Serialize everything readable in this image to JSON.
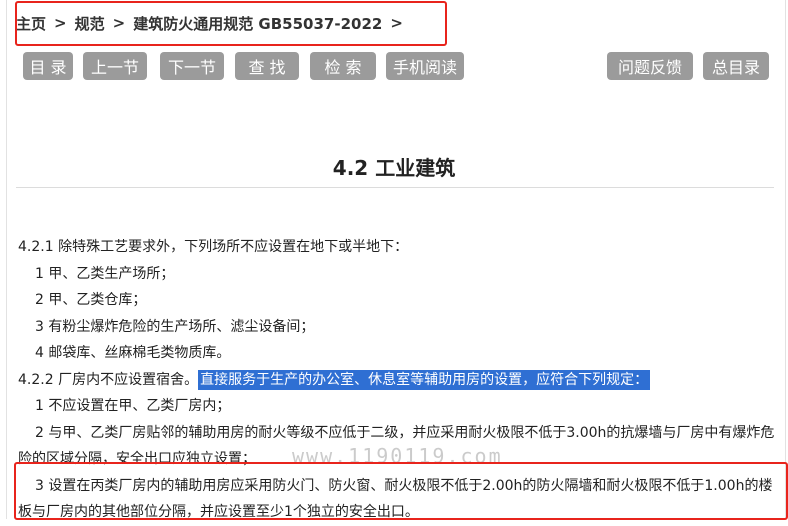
{
  "breadcrumb": {
    "home": "主页",
    "sep": ">",
    "category": "规范",
    "current": "建筑防火通用规范 GB55037-2022"
  },
  "toolbar": {
    "catalog": "目 录",
    "prev": "上一节",
    "next": "下一节",
    "find": "查 找",
    "search": "检 索",
    "mobile": "手机阅读",
    "feedback": "问题反馈",
    "main_catalog": "总目录"
  },
  "page": {
    "title": "4.2 工业建筑"
  },
  "content": {
    "p1": "4.2.1 除特殊工艺要求外，下列场所不应设置在地下或半地下：",
    "p1_item1": "1 甲、乙类生产场所；",
    "p1_item2": "2 甲、乙类仓库；",
    "p1_item3": "3 有粉尘爆炸危险的生产场所、滤尘设备间；",
    "p1_item4": "4 邮袋库、丝麻棉毛类物质库。",
    "p2_a": "4.2.2 厂房内不应设置宿舍。",
    "p2_b": "直接服务于生产的办公室、休息室等辅助用房的设置，应符合下列规定：",
    "p2_item1": "1 不应设置在甲、乙类厂房内；",
    "p2_item2": "2 与甲、乙类厂房贴邻的辅助用房的耐火等级不应低于二级，并应采用耐火极限不低于3.00h的抗爆墙与厂房中有爆炸危险的区域分隔，安全出口应独立设置；",
    "p2_item3": "3 设置在丙类厂房内的辅助用房应采用防火门、防火窗、耐火极限不低于2.00h的防火隔墙和耐火极限不低于1.00h的楼板与厂房内的其他部位分隔，并应设置至少1个独立的安全出口。"
  },
  "watermark": "www.1190119.com",
  "colors": {
    "button_bg": "#9b9b9b",
    "highlight_bg": "#2f6fd3",
    "annotation_red": "#e8241c"
  }
}
